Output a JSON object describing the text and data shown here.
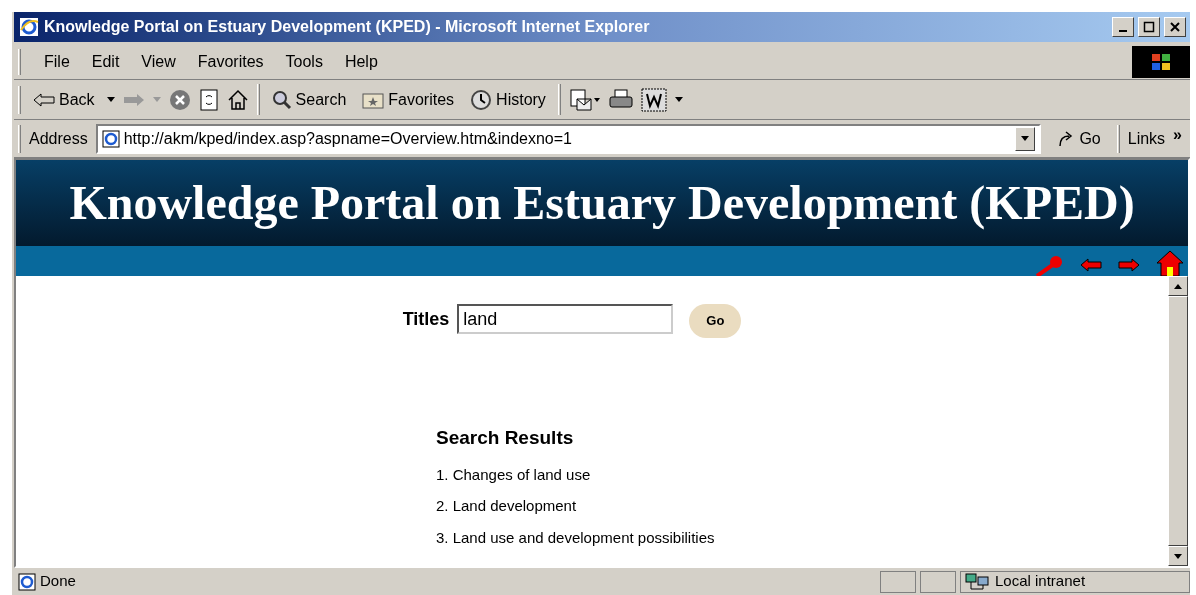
{
  "window": {
    "title": "Knowledge Portal on Estuary Development (KPED) - Microsoft Internet Explorer"
  },
  "menu": [
    "File",
    "Edit",
    "View",
    "Favorites",
    "Tools",
    "Help"
  ],
  "toolbar": {
    "back": "Back",
    "search": "Search",
    "favorites": "Favorites",
    "history": "History"
  },
  "address": {
    "label": "Address",
    "value": "http://akm/kped/index.asp?aspname=Overview.htm&indexno=1",
    "go": "Go",
    "links": "Links",
    "more": "»"
  },
  "page": {
    "banner": "Knowledge Portal on Estuary Development (KPED)",
    "search": {
      "label": "Titles",
      "value": "land",
      "button": "Go"
    },
    "results": {
      "heading": "Search Results",
      "items": [
        "1. Changes of land use",
        "2. Land development",
        "3. Land use and development possibilities"
      ]
    }
  },
  "status_bar": {
    "text": "Done",
    "zone": "Local intranet"
  }
}
